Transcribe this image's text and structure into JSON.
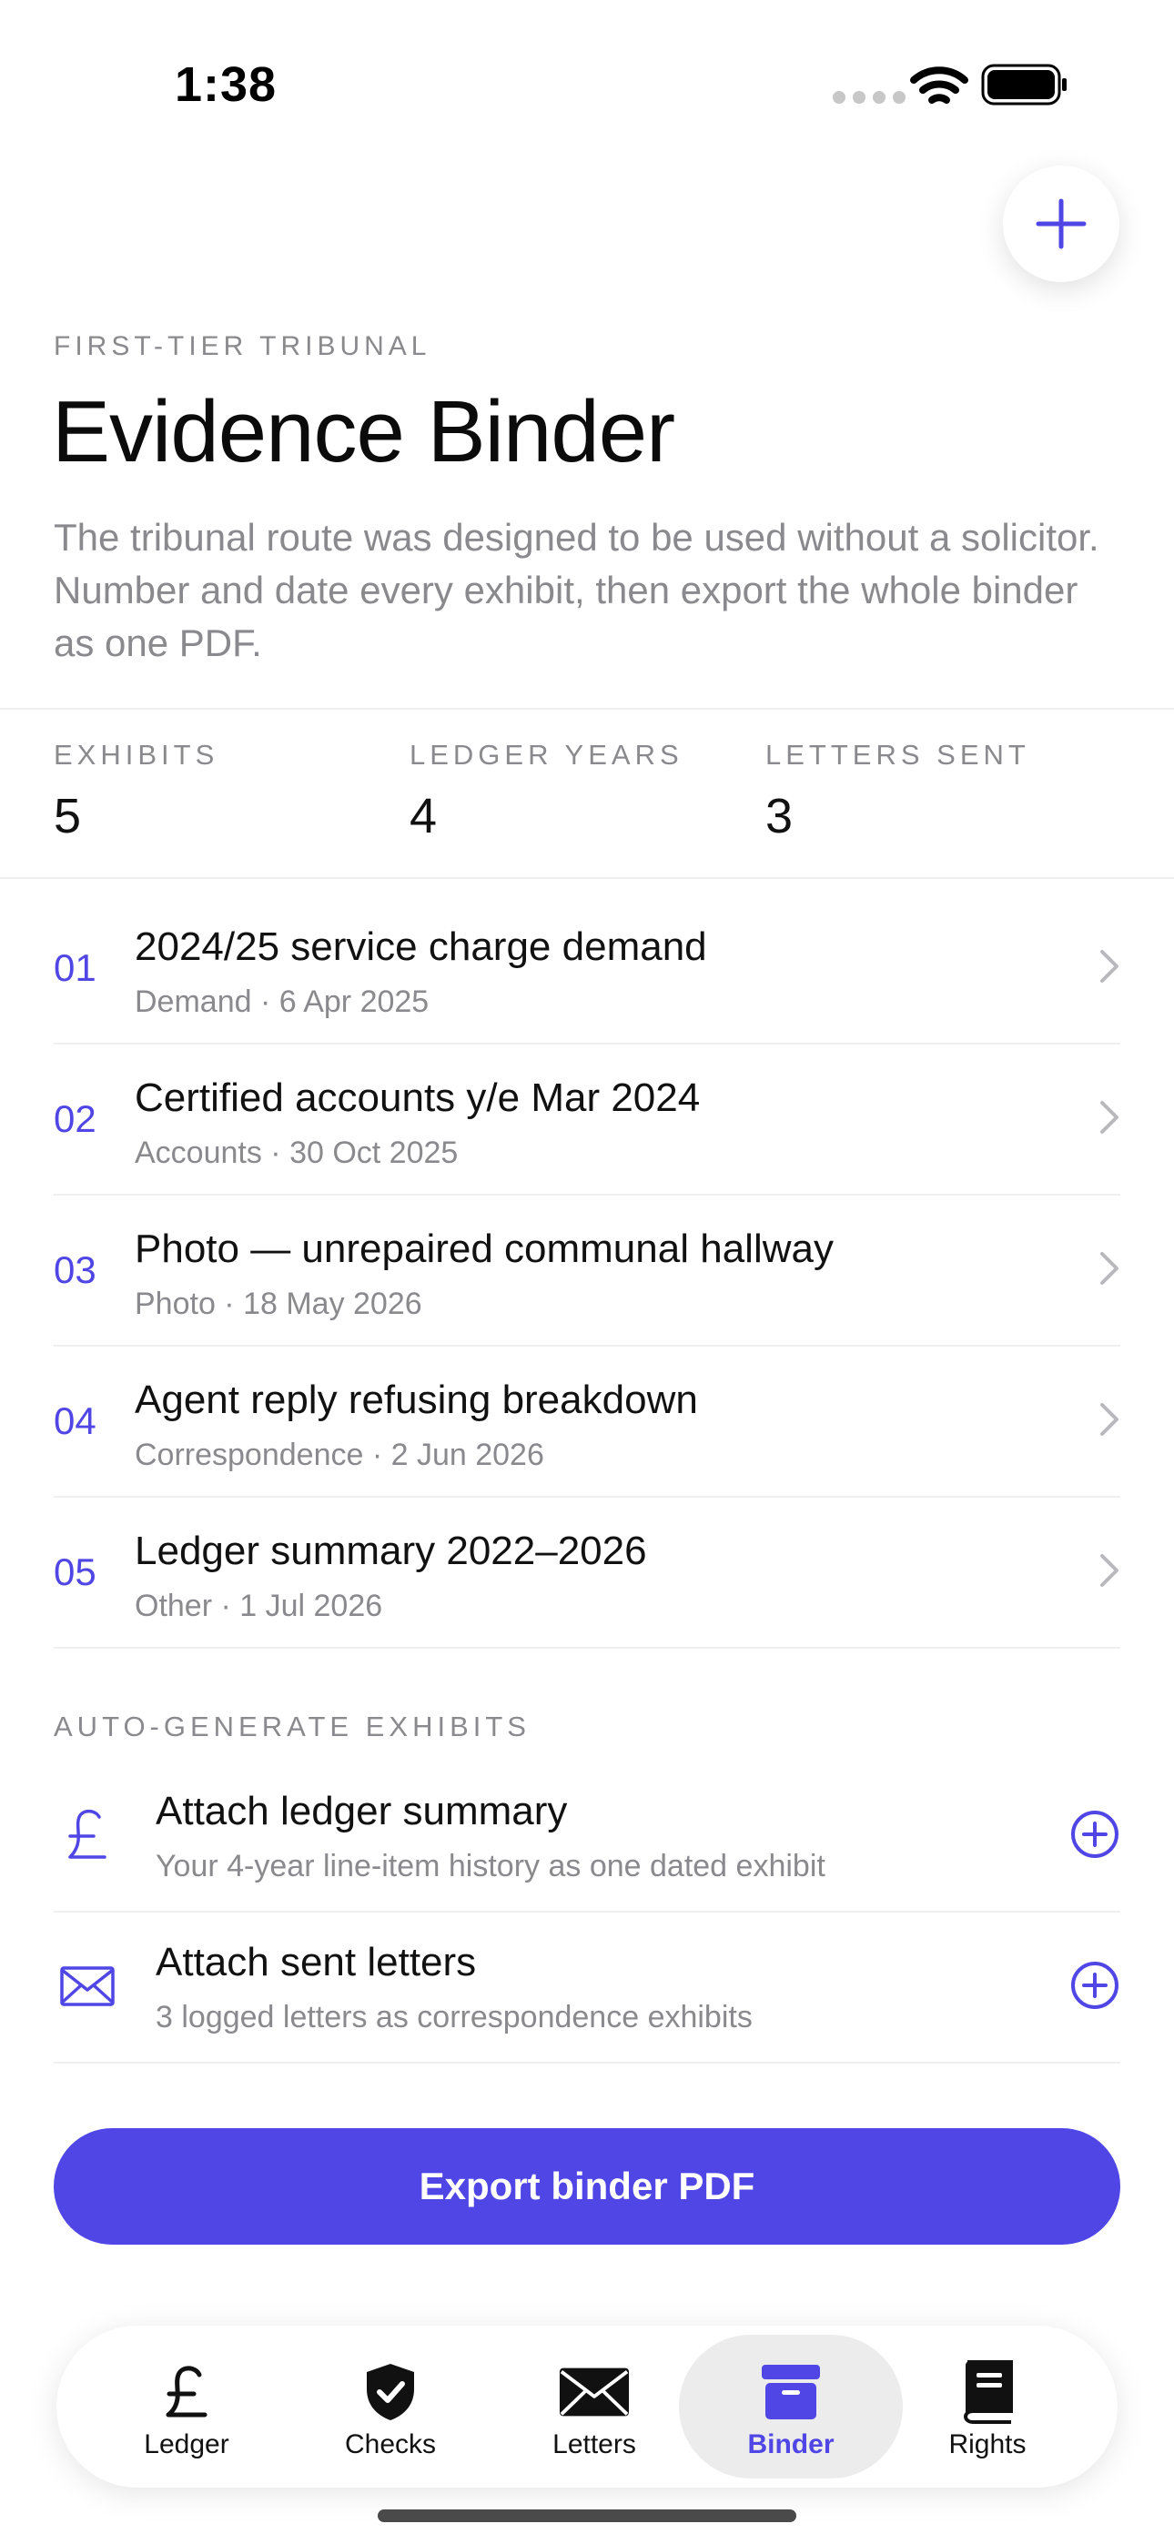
{
  "status_bar": {
    "time": "1:38"
  },
  "header": {
    "eyebrow": "FIRST-TIER TRIBUNAL",
    "title": "Evidence Binder",
    "intro": "The tribunal route was designed to be used without a solicitor. Number and date every exhibit, then export the whole binder as one PDF."
  },
  "stats": [
    {
      "label": "EXHIBITS",
      "value": "5"
    },
    {
      "label": "LEDGER YEARS",
      "value": "4"
    },
    {
      "label": "LETTERS SENT",
      "value": "3"
    }
  ],
  "exhibits": [
    {
      "number": "01",
      "title": "2024/25 service charge demand",
      "meta": "Demand · 6 Apr 2025"
    },
    {
      "number": "02",
      "title": "Certified accounts y/e Mar 2024",
      "meta": "Accounts · 30 Oct 2025"
    },
    {
      "number": "03",
      "title": "Photo — unrepaired communal hallway",
      "meta": "Photo · 18 May 2026"
    },
    {
      "number": "04",
      "title": "Agent reply refusing breakdown",
      "meta": "Correspondence · 2 Jun 2026"
    },
    {
      "number": "05",
      "title": "Ledger summary 2022–2026",
      "meta": "Other · 1 Jul 2026"
    }
  ],
  "auto_generate": {
    "label": "AUTO-GENERATE EXHIBITS",
    "items": [
      {
        "icon": "pound-icon",
        "title": "Attach ledger summary",
        "meta": "Your 4-year line-item history as one dated exhibit"
      },
      {
        "icon": "envelope-icon",
        "title": "Attach sent letters",
        "meta": "3 logged letters as correspondence exhibits"
      }
    ]
  },
  "export_button": "Export binder PDF",
  "tabs": [
    {
      "label": "Ledger",
      "icon": "pound-icon"
    },
    {
      "label": "Checks",
      "icon": "shield-check-icon"
    },
    {
      "label": "Letters",
      "icon": "envelope-icon"
    },
    {
      "label": "Binder",
      "icon": "archive-box-icon",
      "active": true
    },
    {
      "label": "Rights",
      "icon": "book-icon"
    }
  ],
  "colors": {
    "accent": "#4f46e5",
    "muted": "#8a8a8e",
    "tab_active_bg": "#ececec"
  }
}
